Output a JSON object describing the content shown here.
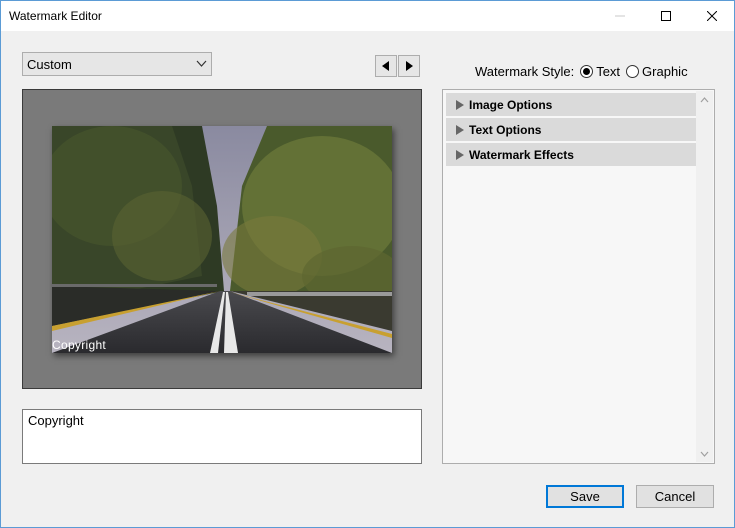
{
  "window": {
    "title": "Watermark Editor"
  },
  "preset": {
    "selected": "Custom"
  },
  "watermark_style": {
    "label": "Watermark Style:",
    "options": [
      {
        "label": "Text",
        "selected": true
      },
      {
        "label": "Graphic",
        "selected": false
      }
    ]
  },
  "preview": {
    "overlay_text": "Copyright"
  },
  "text_input": {
    "value": "Copyright"
  },
  "options_panel": {
    "sections": [
      {
        "label": "Image Options"
      },
      {
        "label": "Text Options"
      },
      {
        "label": "Watermark Effects"
      }
    ]
  },
  "footer": {
    "save_label": "Save",
    "cancel_label": "Cancel"
  },
  "colors": {
    "accent": "#0078d7",
    "window_border": "#5b9bd5",
    "background": "#f0f0f0"
  }
}
